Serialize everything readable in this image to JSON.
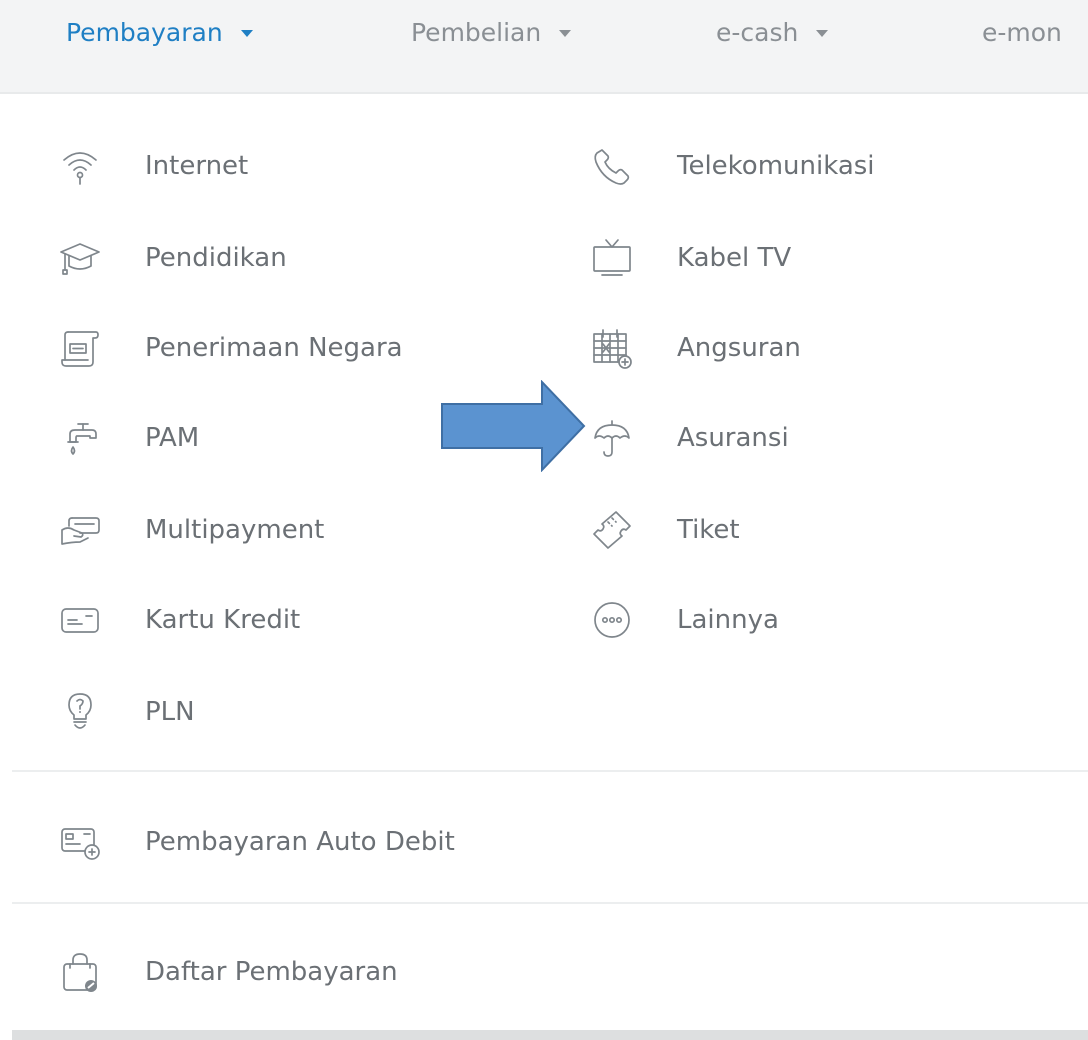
{
  "nav": {
    "tabs": [
      {
        "label": "Pembayaran",
        "active": true
      },
      {
        "label": "Pembelian",
        "active": false
      },
      {
        "label": "e-cash",
        "active": false
      },
      {
        "label": "e-mon",
        "active": false
      }
    ],
    "active_color": "#1f7fc4"
  },
  "menu": {
    "left": [
      {
        "label": "Internet",
        "icon": "wifi-icon"
      },
      {
        "label": "Pendidikan",
        "icon": "graduation-cap-icon"
      },
      {
        "label": "Penerimaan Negara",
        "icon": "tax-scroll-icon"
      },
      {
        "label": "PAM",
        "icon": "water-tap-icon"
      },
      {
        "label": "Multipayment",
        "icon": "card-hand-icon"
      },
      {
        "label": "Kartu Kredit",
        "icon": "credit-card-icon"
      },
      {
        "label": "PLN",
        "icon": "light-bulb-icon"
      }
    ],
    "right": [
      {
        "label": "Telekomunikasi",
        "icon": "phone-icon"
      },
      {
        "label": "Kabel TV",
        "icon": "tv-icon"
      },
      {
        "label": "Angsuran",
        "icon": "calendar-icon"
      },
      {
        "label": "Asuransi",
        "icon": "umbrella-icon"
      },
      {
        "label": "Tiket",
        "icon": "ticket-icon"
      },
      {
        "label": "Lainnya",
        "icon": "more-icon"
      }
    ]
  },
  "extra": {
    "auto_debit": {
      "label": "Pembayaran Auto Debit",
      "icon": "auto-debit-card-icon"
    },
    "payment_list": {
      "label": "Daftar Pembayaran",
      "icon": "bag-icon"
    }
  },
  "annotation": {
    "arrow_color": "#5b93d0",
    "arrow_icon": "right-arrow-icon"
  }
}
